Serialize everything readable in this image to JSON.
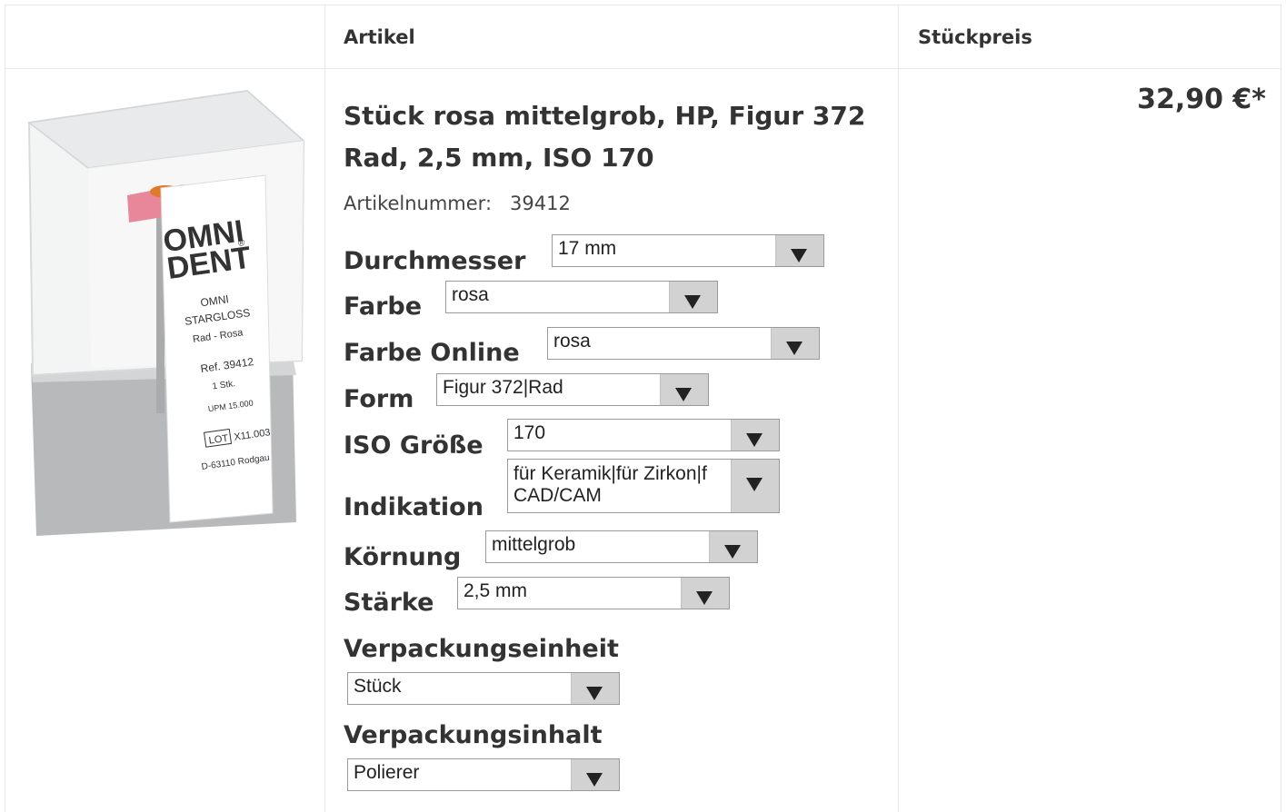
{
  "table": {
    "headers": {
      "article": "Artikel",
      "unit_price": "Stückpreis"
    }
  },
  "product": {
    "image": {
      "brand_line1": "OMNI",
      "brand_line2": "DENT",
      "registered": "®",
      "label_lines": [
        "OMNI",
        "STARGLOSS",
        "Rad - Rosa",
        "Ref. 39412",
        "1 Stk.",
        "UPM 15.000",
        "LOT",
        "X11.003",
        "D-63110 Rodgau"
      ]
    },
    "title": "Stück rosa mittelgrob, HP, Figur 372 Rad, 2,5 mm, ISO 170",
    "article_number_label": "Artikelnummer:",
    "article_number": "39412",
    "price": "32,90 €*"
  },
  "options": {
    "durchmesser": {
      "label": "Durchmesser",
      "value": "17 mm"
    },
    "farbe": {
      "label": "Farbe",
      "value": "rosa"
    },
    "farbe_online": {
      "label": "Farbe Online",
      "value": "rosa"
    },
    "form": {
      "label": "Form",
      "value": "Figur 372|Rad"
    },
    "iso_groesse": {
      "label": "ISO Größe",
      "value": "170"
    },
    "indikation": {
      "label": "Indikation",
      "value": "für Keramik|für Zirkon|f CAD/CAM"
    },
    "koernung": {
      "label": "Körnung",
      "value": "mittelgrob"
    },
    "staerke": {
      "label": "Stärke",
      "value": "2,5 mm"
    },
    "verpackungseinheit": {
      "label": "Verpackungseinheit",
      "value": "Stück"
    },
    "verpackungsinhalt": {
      "label": "Verpackungsinhalt",
      "value": "Polierer"
    }
  },
  "icons": {
    "dropdown": "dropdown-arrow-icon"
  },
  "colors": {
    "border": "#e8e8e8",
    "text": "#333333",
    "select_button": "#d2d2d2"
  }
}
